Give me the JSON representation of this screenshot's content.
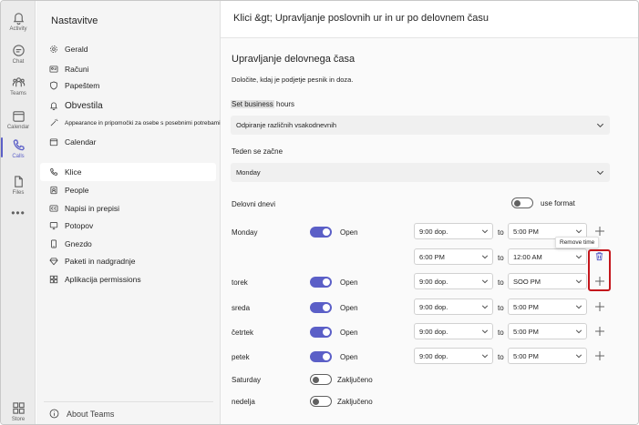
{
  "rail": {
    "items": [
      {
        "label": "Activity",
        "icon": "bell-icon"
      },
      {
        "label": "Chat",
        "icon": "chat-icon"
      },
      {
        "label": "Teams",
        "icon": "teams-icon"
      },
      {
        "label": "Calendar",
        "icon": "calendar-icon"
      },
      {
        "label": "Calls",
        "icon": "phone-icon"
      },
      {
        "label": "Files",
        "icon": "file-icon"
      }
    ],
    "more": "•••",
    "store": "Store",
    "accent": "#5b5fc7"
  },
  "sidebar": {
    "title": "Nastavitve",
    "items": [
      {
        "label": "Gerald",
        "icon": "gear-icon"
      },
      {
        "label": "Računi",
        "icon": "id-card-icon"
      },
      {
        "label": "Papeštem",
        "icon": "shield-icon"
      },
      {
        "label": "Obvestila",
        "icon": "bell-icon"
      },
      {
        "label": "Appearance in pripomočki za osebe s posebnimi potrebami",
        "icon": "wand-icon"
      },
      {
        "label": "Calendar",
        "icon": "calendar-icon"
      },
      {
        "label": "Klice",
        "icon": "phone-icon"
      },
      {
        "label": "People",
        "icon": "people-icon"
      },
      {
        "label": "Napisi in prepisi",
        "icon": "cc-icon"
      },
      {
        "label": "Potopov",
        "icon": "monitor-icon"
      },
      {
        "label": "Gnezdo",
        "icon": "device-icon"
      },
      {
        "label": "Paketi in nadgradnje",
        "icon": "diamond-icon"
      },
      {
        "label": "Aplikacija permissions",
        "icon": "grid-icon"
      }
    ],
    "about": "About Teams"
  },
  "header": {
    "breadcrumb": "Klici &gt;  Upravljanje poslovnih ur in ur po delovnem času"
  },
  "main": {
    "title": "Upravljanje delovnega časa",
    "description": "Določite, kdaj je podjetje pesnik  in doza.",
    "set_hours_highlight": "Set business",
    "set_hours_rest": "hours",
    "hours_select": "Odpiranje  različnih  vsakodnevnih",
    "week_start_label": "Teden se začne",
    "week_start_value": "Monday",
    "work_days_label": "Delovni dnevi",
    "use_format": "use format",
    "tooltip": "Remove time",
    "to": "to",
    "days": [
      {
        "name": "Monday",
        "on": true,
        "status": "Open",
        "from": "9:00 dop.",
        "until": "5:00 PM",
        "action": "add"
      },
      {
        "name": "",
        "on": true,
        "status": "",
        "from": "6:00 PM",
        "until": "12:00 AM",
        "action": "remove"
      },
      {
        "name": "torek",
        "on": true,
        "status": "Open",
        "from": "9:00 dop.",
        "until": "SOO PM",
        "action": "add"
      },
      {
        "name": "sreda",
        "on": true,
        "status": "Open",
        "from": "9:00 dop.",
        "until": "5:00 PM",
        "action": "add"
      },
      {
        "name": "četrtek",
        "on": true,
        "status": "Open",
        "from": "9:00 dop.",
        "until": "5:00 PM",
        "action": "add"
      },
      {
        "name": "petek",
        "on": true,
        "status": "Open",
        "from": "9:00 dop.",
        "until": "5:00 PM",
        "action": "add"
      },
      {
        "name": "Saturday",
        "on": false,
        "status": "Zaključeno"
      },
      {
        "name": "nedelja",
        "on": false,
        "status": "Zaključeno"
      }
    ]
  }
}
